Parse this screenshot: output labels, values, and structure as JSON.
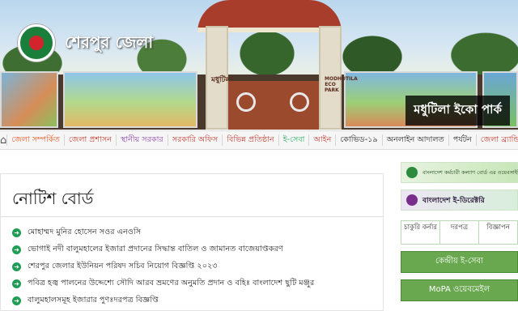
{
  "header": {
    "site_title": "শেরপুর জেলা",
    "park_label": "মধুটিলা ইকো পার্ক",
    "gate_left_text": "মধুটিলা",
    "gate_right_text": "MODHUTILA ECO PARK"
  },
  "nav": {
    "home_icon": "home-icon",
    "items": [
      {
        "label": "জেলা সম্পর্কিত",
        "color": "#e8531e"
      },
      {
        "label": "জেলা প্রশাসন",
        "color": "#c0392b"
      },
      {
        "label": "স্থানীয় সরকার",
        "color": "#8e44ad"
      },
      {
        "label": "সরকারি অফিস",
        "color": "#c0392b"
      },
      {
        "label": "বিভিন্ন প্রতিষ্ঠান",
        "color": "#c0392b"
      },
      {
        "label": "ই-সেবা",
        "color": "#27ae60"
      },
      {
        "label": "আইন",
        "color": "#c0392b"
      },
      {
        "label": "কোভিড-১৯",
        "color": "#222222"
      },
      {
        "label": "অনলাইন আদালত",
        "color": "#222222"
      },
      {
        "label": "পর্যটন",
        "color": "#222222"
      },
      {
        "label": "জেলা ব্র্যান্ডিং",
        "color": "#c0392b"
      }
    ]
  },
  "notice_board": {
    "title": "নোটিশ বোর্ড",
    "items": [
      "মোহাম্মদ মুনির হোসেন সওর এনওসি",
      "ভোগাই নদী বালুমহালের ইজারা প্রদানের সিদ্ধান্ত বাতিল ও জামানত বাজেয়াপ্তকরণ",
      "শেরপুর জেলার ইউনিয়ন পরিষদ সচিব নিয়োগ বিজ্ঞপ্তি ২০২৩",
      "পবিত্র হজ্ব পালনের উদ্দেশ্যে সৌদি আরব ভ্রমণের অনুমতি প্রদান ও বহিঃ বাংলাদেশ ছুটি মঞ্জুর",
      "বালুমহালসমূহ ইজারার পুণঃদরপত্র বিজ্ঞপ্তি"
    ]
  },
  "sidebar": {
    "banner1": "বাংলাদেশ কর্মচারী কল্যাণ বোর্ড এর ওয়েবসাইট",
    "banner2": "বাংলাদেশ ই-ডিরেক্টরি",
    "tabs": [
      "চাকুরি কর্নার",
      "দরপত্র",
      "বিজ্ঞাপন"
    ],
    "buttons": [
      "কেন্দ্রীয় ই-সেবা",
      "MoPA ওয়েবমেইল"
    ]
  }
}
